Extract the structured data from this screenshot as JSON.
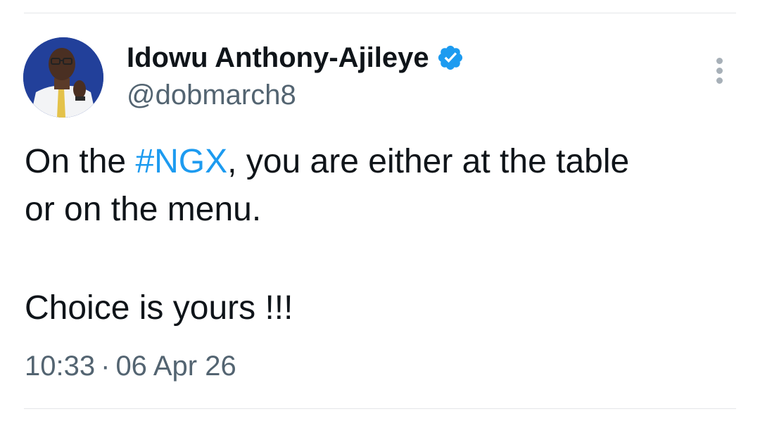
{
  "author": {
    "display_name": "Idowu Anthony-Ajileye",
    "handle": "@dobmarch8",
    "verified_icon": "verified-badge-icon"
  },
  "tweet": {
    "line1_before": "On the ",
    "hashtag": "#NGX",
    "line1_after": ", you are either at the table",
    "line2": "or on the menu.",
    "line3": "Choice is yours !!!"
  },
  "meta": {
    "time": "10:33",
    "separator": "·",
    "date": "06 Apr 26"
  },
  "colors": {
    "accent": "#1d9bf0",
    "text": "#0f1419",
    "secondary": "#536471",
    "divider": "#e4e6e8"
  }
}
